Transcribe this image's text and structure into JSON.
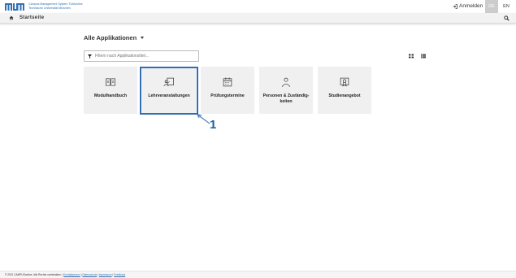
{
  "header": {
    "brand_line1": "Campus Management System TUMonline",
    "brand_line2": "Technische Universität München",
    "login_label": "Anmelden",
    "lang_de": "DE",
    "lang_en": "EN"
  },
  "nav": {
    "title": "Startseite"
  },
  "main": {
    "heading": "Alle Applikationen",
    "filter_placeholder": "Filtern nach Applikationstitel..."
  },
  "tiles": [
    {
      "label": "Modulhandbuch",
      "icon": "book-icon"
    },
    {
      "label": "Lehrveranstaltungen",
      "icon": "lecture-icon"
    },
    {
      "label": "Prüfungstermine",
      "icon": "calendar-icon"
    },
    {
      "label": "Personen & Zuständig-keiten",
      "icon": "people-icon"
    },
    {
      "label": "Studienangebot",
      "icon": "certificate-icon"
    }
  ],
  "annotation": {
    "number": "1",
    "color": "#2f6db5"
  },
  "footer": {
    "copyright": "© 2021 CAMPUSonline. Alle Rechte vorbehalten.",
    "links": [
      "Kontaktperson",
      "Datenschutz",
      "Impressum",
      "Feedback"
    ]
  },
  "colors": {
    "brand": "#3070b3",
    "tile_bg": "#f0f0f0",
    "nav_bg": "#f2f2f2"
  }
}
